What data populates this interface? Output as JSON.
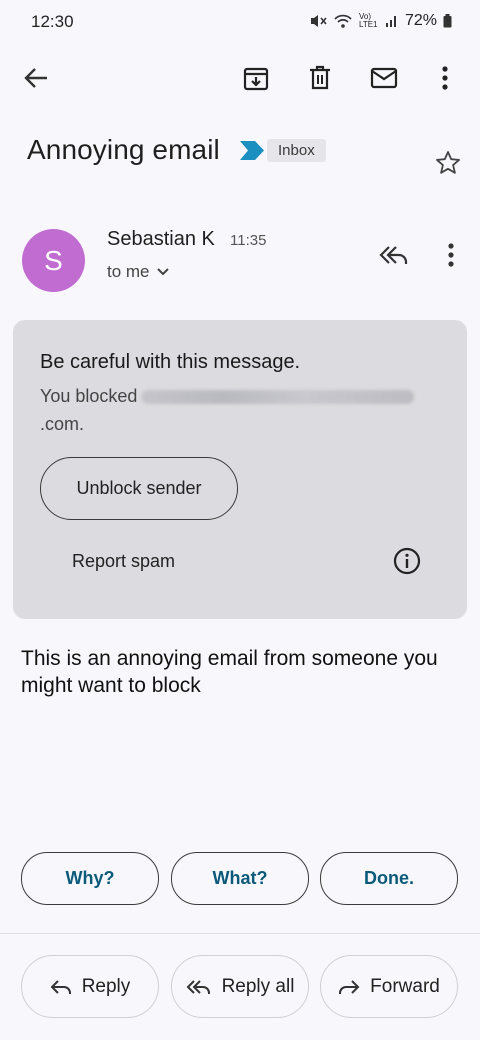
{
  "status_bar": {
    "time": "12:30",
    "network_label": "Vo) LTE1",
    "battery": "72%"
  },
  "app_bar": {
    "icons": [
      "back-arrow-icon",
      "move-to-inbox-icon",
      "trash-icon",
      "mail-icon",
      "more-vert-icon"
    ]
  },
  "email": {
    "subject": "Annoying email",
    "label": "Inbox",
    "sender_initial": "S",
    "sender_name": "Sebastian K",
    "time": "11:35",
    "recipient": "to me",
    "avatar_color": "#c06cd0",
    "body": "This is an annoying email from someone you might want to block"
  },
  "warning": {
    "title": "Be careful with this message.",
    "line1": "You blocked",
    "line2": ".com.",
    "unblock_label": "Unblock sender",
    "report_label": "Report spam"
  },
  "smart_replies": [
    "Why?",
    "What?",
    "Done."
  ],
  "actions": {
    "reply": "Reply",
    "reply_all": "Reply all",
    "forward": "Forward"
  },
  "colors": {
    "smart_reply_text": "#0b5a7a",
    "important_marker": "#1a8fc0"
  }
}
